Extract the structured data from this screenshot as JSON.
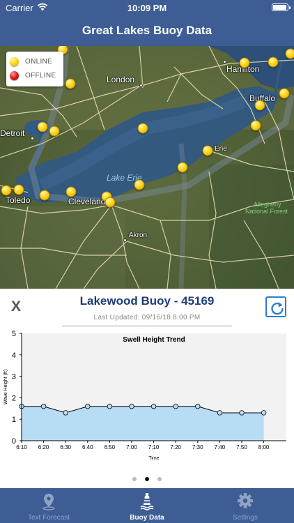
{
  "status_bar": {
    "carrier": "Carrier",
    "time": "10:09 PM",
    "battery_level": 0.95
  },
  "nav": {
    "title": "Great Lakes Buoy Data"
  },
  "map": {
    "legend": {
      "online_label": "ONLINE",
      "offline_label": "OFFLINE"
    },
    "labels": {
      "london": "London",
      "hamilton": "Hamilton",
      "buffalo": "Buffalo",
      "detroit": "Detroit",
      "erie": "Erie",
      "lake_erie": "Lake Erie",
      "toledo": "Toledo",
      "cleveland": "Cleveland",
      "akron": "Akron",
      "allegheny_line1": "Allegheny",
      "allegheny_line2": "National Forest"
    },
    "buoy_status": "online"
  },
  "detail": {
    "close_label": "X",
    "buoy_title": "Lakewood Buoy - 45169",
    "last_updated": "Last Updated: 09/16/18 8:00 PM",
    "pages": {
      "count": 3,
      "active": 2
    }
  },
  "chart_data": {
    "type": "area",
    "title": "Swell Height Trend",
    "xlabel": "Time",
    "ylabel": "Wave Height (ft)",
    "categories": [
      "6:10",
      "6:20",
      "6:30",
      "6:40",
      "6:50",
      "7:00",
      "7:10",
      "7:20",
      "7:30",
      "7:40",
      "7:50",
      "8:00"
    ],
    "values": [
      1.6,
      1.6,
      1.3,
      1.6,
      1.6,
      1.6,
      1.6,
      1.6,
      1.6,
      1.3,
      1.3,
      1.3
    ],
    "ylim": [
      0,
      5
    ],
    "yticks": [
      0,
      1,
      2,
      3,
      4,
      5
    ],
    "fill_color": "#b9dcf5",
    "line_color": "#000000",
    "marker_color": "#b9dcf5"
  },
  "tabs": [
    {
      "label": "Text Forecast",
      "icon": "map-pin-icon",
      "active": false
    },
    {
      "label": "Buoy Data",
      "icon": "buoy-icon",
      "active": true
    },
    {
      "label": "Settings",
      "icon": "gear-icon",
      "active": false
    }
  ],
  "colors": {
    "nav": "#3d5d94",
    "accent": "#2a7fd4",
    "title": "#1e3c78"
  }
}
